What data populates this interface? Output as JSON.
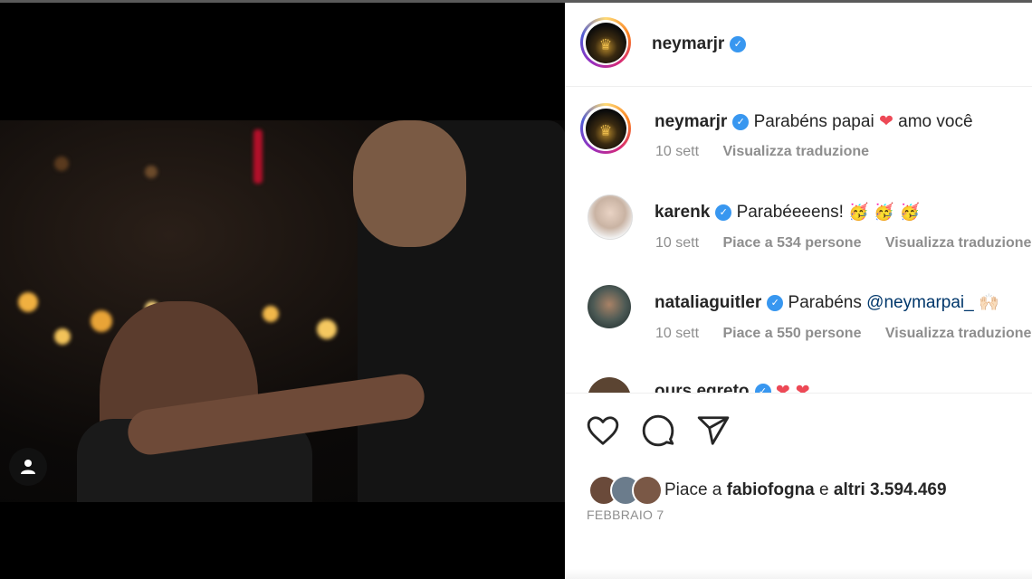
{
  "header": {
    "username": "neymarjr",
    "verified_icon": "verified-badge-icon"
  },
  "comments": [
    {
      "username": "neymarjr",
      "text_before": "Parabéns papai",
      "emoji": "❤",
      "text_after": "amo você",
      "time": "10 sett",
      "likes": "",
      "translate": "Visualizza traduzione"
    },
    {
      "username": "karenk",
      "text": "Parabéeeens!",
      "emoji": "🥳 🥳 🥳",
      "time": "10 sett",
      "likes": "Piace a 534 persone",
      "translate": "Visualizza traduzione"
    },
    {
      "username": "nataliaguitler",
      "text": "Parabéns",
      "mention": "@neymarpai_",
      "emoji": "🙌🏻",
      "time": "10 sett",
      "likes": "Piace a 550 persone",
      "translate": "Visualizza traduzione"
    },
    {
      "username": "ours.egreto",
      "emoji": "❤ ❤"
    }
  ],
  "actions": {
    "like_icon": "heart-icon",
    "comment_icon": "comment-icon",
    "share_icon": "send-icon"
  },
  "likes": {
    "prefix": "Piace a",
    "user": "fabiofogna",
    "middle": "e",
    "rest": "altri 3.594.469"
  },
  "date": "FEBBRAIO 7",
  "colors": {
    "accent_blue": "#3897f0",
    "heart_red": "#ed4956",
    "text_primary": "#262626",
    "text_secondary": "#8e8e8e"
  }
}
